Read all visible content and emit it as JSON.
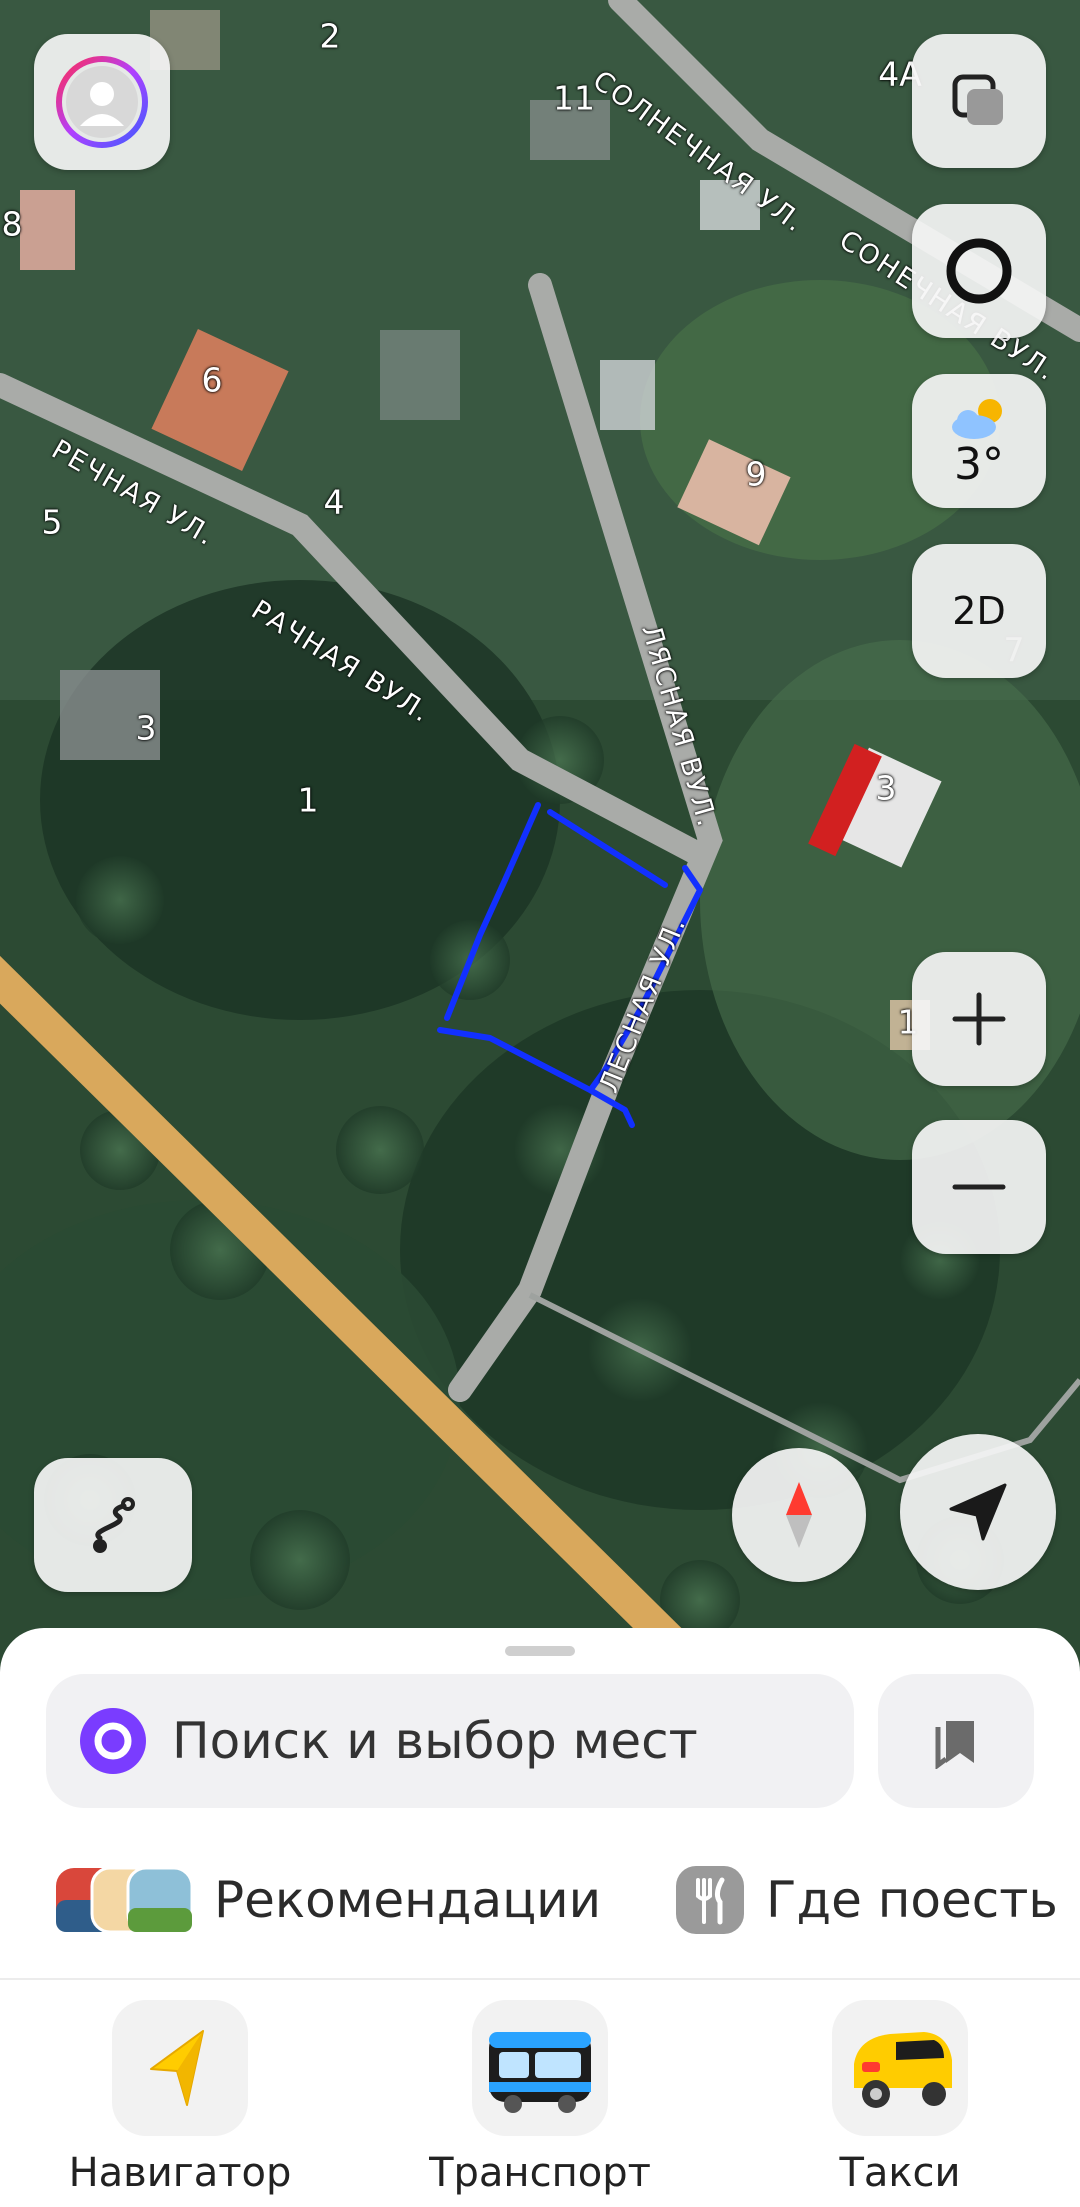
{
  "map": {
    "house_numbers": [
      "2",
      "11",
      "4А",
      "8",
      "6",
      "9",
      "5",
      "4",
      "3",
      "1",
      "3",
      "7",
      "1"
    ],
    "streets": {
      "solnechnaya_1": "СОЛНЕЧНАЯ УЛ.",
      "solnechnaya_2": "СОНЕЧНАЯ ВУЛ.",
      "rechnaya": "РЕЧНАЯ УЛ.",
      "rachnaya": "РАЧНАЯ ВУЛ.",
      "lyasnaya": "ЛЯСНАЯ ВУЛ.",
      "lesnaya": "ЛЕСНАЯ УЛ."
    },
    "colors": {
      "drawn_outline": "#1230ff",
      "main_road": "#d9a85c",
      "local_road": "#a9aba8"
    }
  },
  "controls": {
    "profile": {
      "icon": "profile-icon"
    },
    "layers": {
      "icon": "layers-icon"
    },
    "assistant": {
      "icon": "alice-ring-icon"
    },
    "weather": {
      "icon": "weather-cloud-sun-icon",
      "temperature": "3°"
    },
    "view_mode": {
      "label": "2D"
    },
    "zoom_in": {
      "icon": "plus-icon"
    },
    "zoom_out": {
      "icon": "minus-icon"
    },
    "route": {
      "icon": "route-icon"
    },
    "compass": {
      "icon": "compass-icon"
    },
    "my_location": {
      "icon": "navigation-arrow-icon"
    }
  },
  "sheet": {
    "search_placeholder": "Поиск и выбор мест",
    "chips": [
      {
        "label": "Рекомендации",
        "icon": "recommendations-icon"
      },
      {
        "label": "Где поесть",
        "icon": "fork-knife-icon"
      }
    ],
    "nav": [
      {
        "label": "Навигатор",
        "icon": "navigator-arrow-icon"
      },
      {
        "label": "Транспорт",
        "icon": "bus-icon"
      },
      {
        "label": "Такси",
        "icon": "taxi-icon"
      }
    ],
    "accent_color": "#7a3cff"
  }
}
